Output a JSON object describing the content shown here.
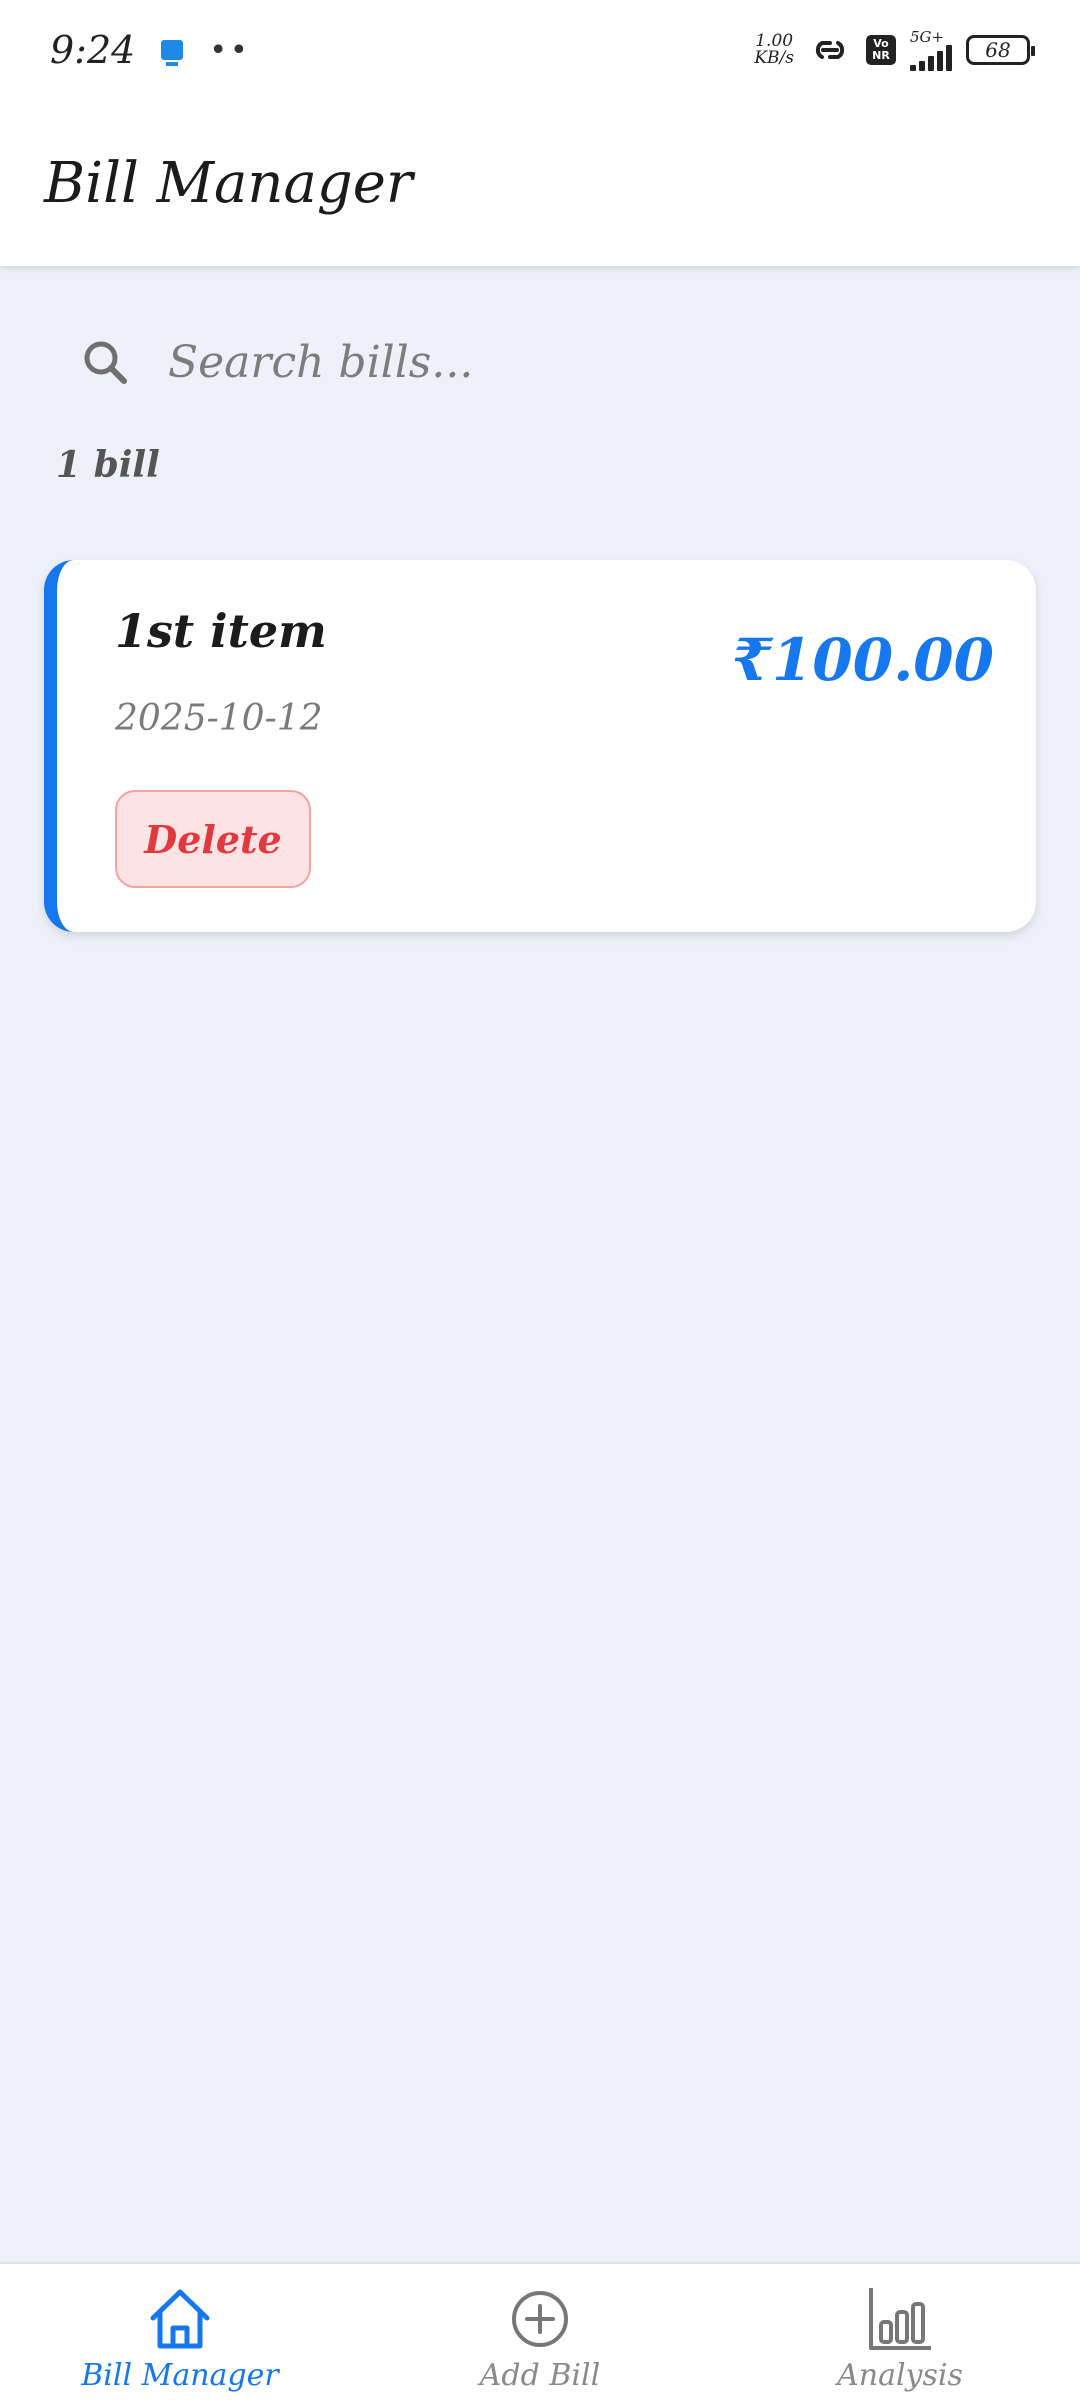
{
  "status_bar": {
    "time": "9:24",
    "net_speed_value": "1.00",
    "net_speed_unit": "KB/s",
    "vonr_line1": "Vo",
    "vonr_line2": "NR",
    "signal_label": "5G+",
    "battery": "68"
  },
  "app_bar": {
    "title": "Bill Manager"
  },
  "search": {
    "placeholder": "Search bills..."
  },
  "bill_count": "1 bill",
  "bills": [
    {
      "name": "1st item",
      "date": "2025-10-12",
      "amount": "₹100.00",
      "delete_label": "Delete"
    }
  ],
  "bottom_nav": {
    "items": [
      {
        "label": "Bill Manager",
        "icon": "home-icon",
        "active": true
      },
      {
        "label": "Add Bill",
        "icon": "add-circle-icon",
        "active": false
      },
      {
        "label": "Analysis",
        "icon": "bar-chart-icon",
        "active": false
      }
    ]
  },
  "colors": {
    "accent": "#1677ee",
    "danger": "#e0393e",
    "background": "#eef1f9"
  }
}
